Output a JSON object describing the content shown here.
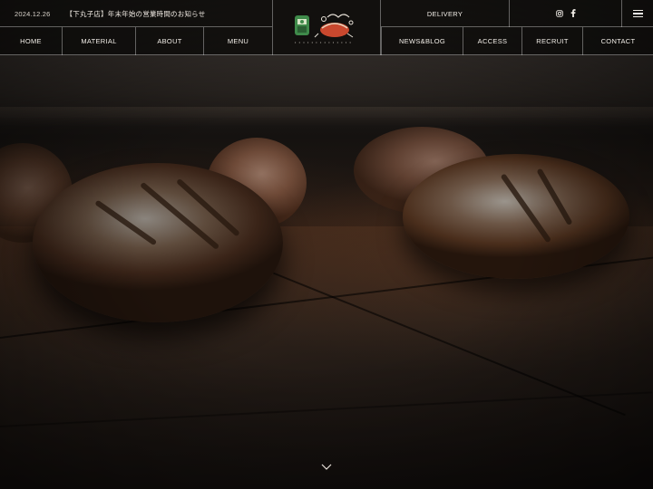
{
  "header": {
    "news": {
      "date": "2024.12.26",
      "title": "【下丸子店】年末年始の営業時間のお知らせ"
    },
    "nav_left": [
      {
        "label": "HOME",
        "name": "nav-home"
      },
      {
        "label": "MATERIAL",
        "name": "nav-material"
      },
      {
        "label": "ABOUT",
        "name": "nav-about"
      },
      {
        "label": "MENU",
        "name": "nav-menu"
      }
    ],
    "nav_right": [
      {
        "label": "NEWS&BLOG",
        "name": "nav-news-blog"
      },
      {
        "label": "ACCESS",
        "name": "nav-access"
      },
      {
        "label": "RECRUIT",
        "name": "nav-recruit"
      },
      {
        "label": "CONTACT",
        "name": "nav-contact"
      }
    ],
    "delivery_label": "DELIVERY",
    "social": [
      "instagram-icon",
      "facebook-icon"
    ],
    "menu_icon": "hamburger-icon"
  },
  "hero": {
    "scroll_icon": "chevron-down-icon"
  },
  "colors": {
    "header_bg": "#0a0908",
    "text": "#f1ede7",
    "logo_green": "#3f8a4a",
    "logo_red": "#c9482e"
  }
}
